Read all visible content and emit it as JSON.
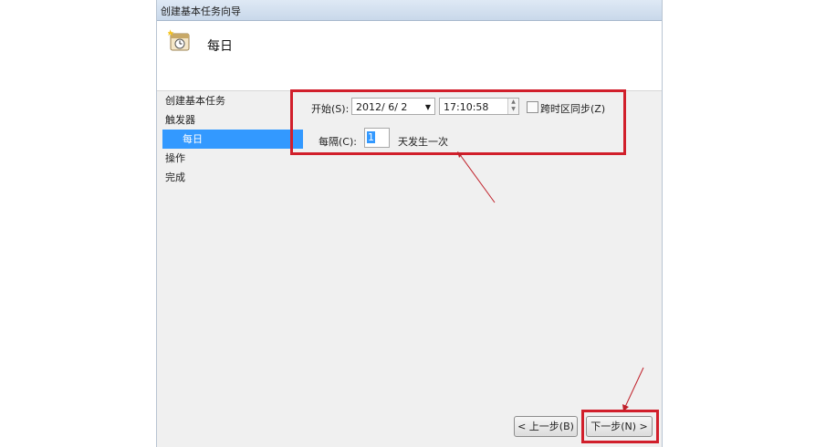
{
  "window": {
    "title": "创建基本任务向导"
  },
  "header": {
    "title": "每日",
    "icon": "task-calendar-icon"
  },
  "nav": {
    "items": [
      {
        "label": "创建基本任务"
      },
      {
        "label": "触发器"
      },
      {
        "label": "每日",
        "selected": true
      },
      {
        "label": "操作"
      },
      {
        "label": "完成"
      }
    ]
  },
  "form": {
    "start_label": "开始(S):",
    "start_date": "2012/ 6/ 2",
    "start_time": "17:10:58",
    "sync_label": "跨时区同步(Z)",
    "sync_checked": false,
    "recur_label": "每隔(C):",
    "recur_value": "1",
    "recur_suffix": "天发生一次"
  },
  "buttons": {
    "back_label": "< 上一步(B)",
    "next_label": "下一步(N) >"
  },
  "colors": {
    "highlight": "#d11f2b",
    "selection": "#3399ff"
  }
}
